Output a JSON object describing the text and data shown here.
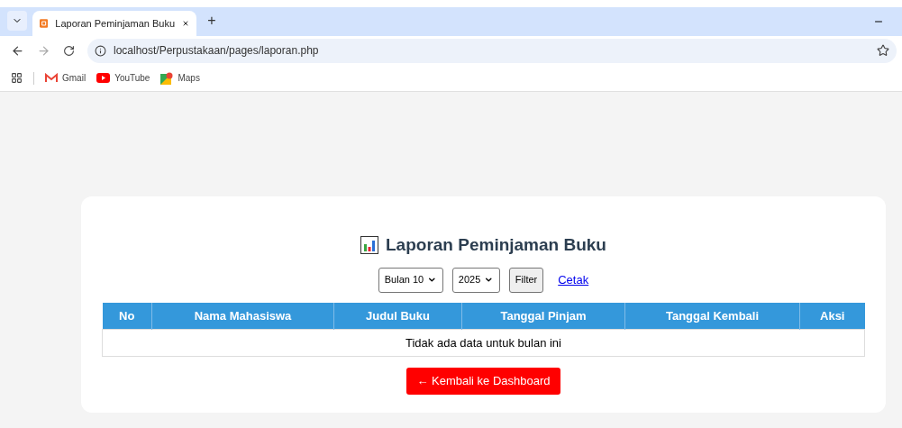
{
  "browser": {
    "tab": {
      "title": "Laporan Peminjaman Buku",
      "selected": true
    },
    "new_tab": "+",
    "address": "localhost/Perpustakaan/pages/laporan.php",
    "bookmarks": [
      {
        "label": "Gmail",
        "kind": "gmail"
      },
      {
        "label": "YouTube",
        "kind": "youtube"
      },
      {
        "label": "Maps",
        "kind": "maps"
      }
    ]
  },
  "page": {
    "title": "Laporan Peminjaman Buku",
    "month_select": {
      "value": "Bulan 10"
    },
    "year_select": {
      "value": "2025"
    },
    "filter_button": "Filter",
    "print_link": "Cetak",
    "table": {
      "columns": [
        "No",
        "Nama Mahasiswa",
        "Judul Buku",
        "Tanggal Pinjam",
        "Tanggal Kembali",
        "Aksi"
      ],
      "empty_message": "Tidak ada data untuk bulan ini"
    },
    "back_button": "← Kembali ke Dashboard"
  }
}
